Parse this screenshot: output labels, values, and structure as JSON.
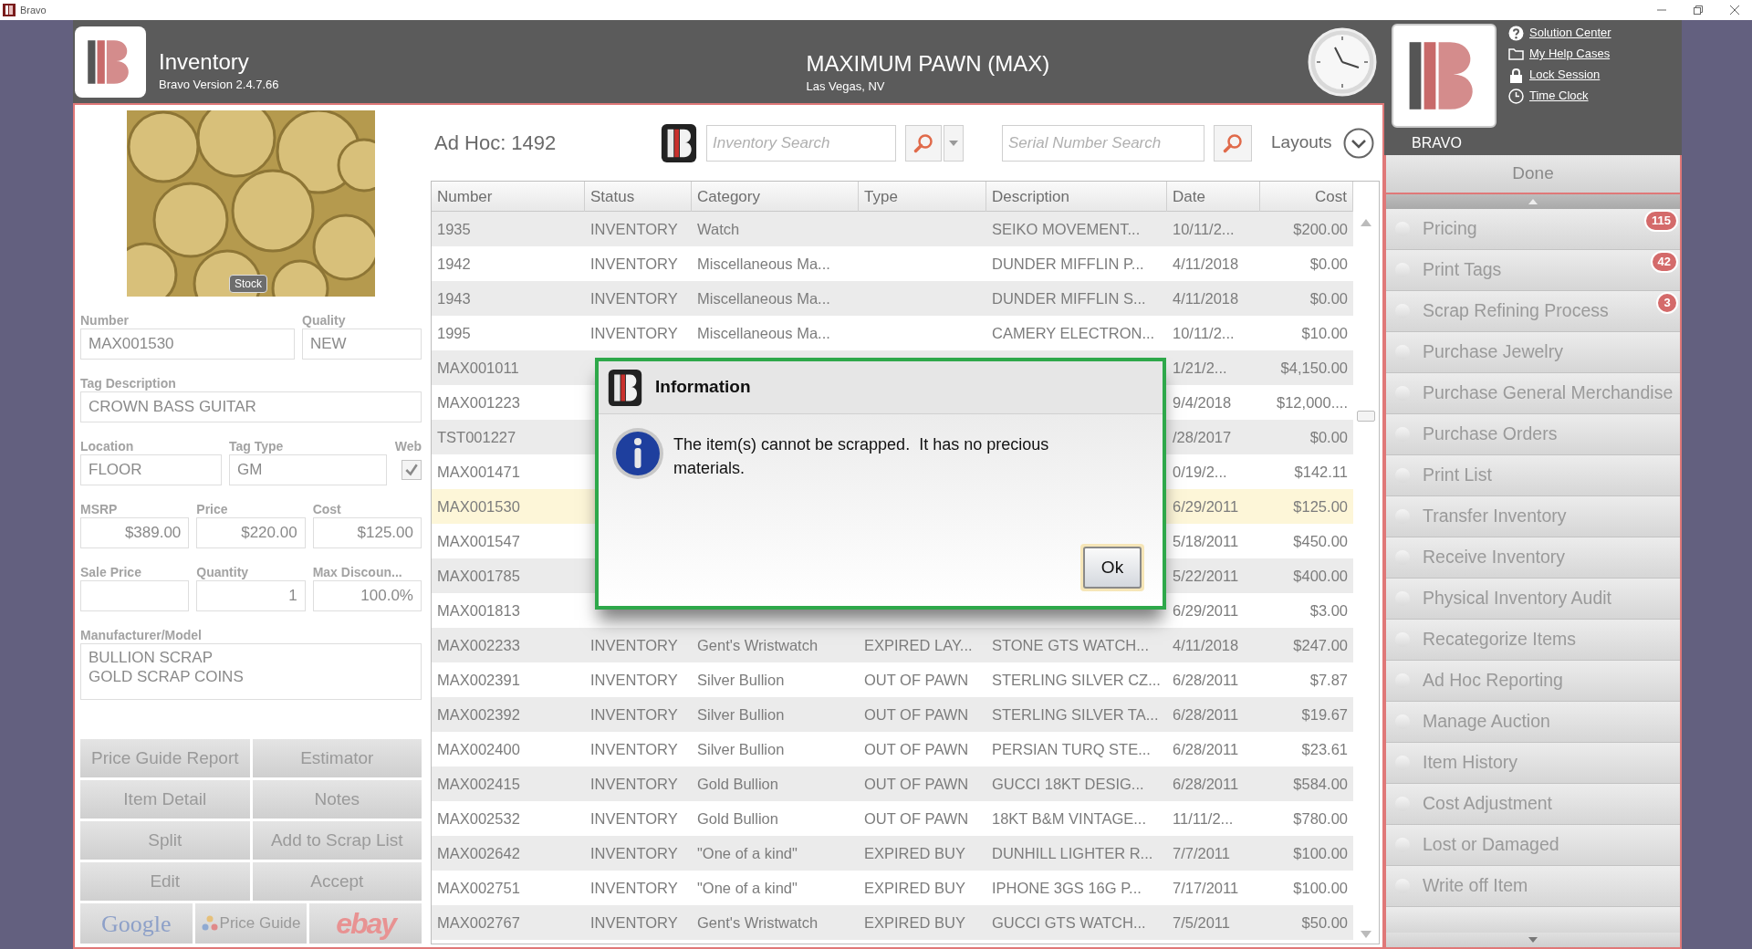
{
  "window": {
    "title": "Bravo"
  },
  "header": {
    "module": "Inventory",
    "version": "Bravo Version 2.4.7.66",
    "store": "MAXIMUM PAWN (MAX)",
    "location": "Las Vegas, NV",
    "brand_label": "BRAVO",
    "links": [
      {
        "kind": "help",
        "label": "Solution Center"
      },
      {
        "kind": "folder",
        "label": "My Help Cases"
      },
      {
        "kind": "lock",
        "label": "Lock Session"
      },
      {
        "kind": "clock",
        "label": "Time Clock"
      }
    ]
  },
  "item_form": {
    "image_badge": "Stock",
    "fields": [
      {
        "label": "Number",
        "value": "MAX001530",
        "kind": "text"
      },
      {
        "label": "Quality",
        "value": "NEW",
        "kind": "text"
      },
      {
        "label": "Tag Description",
        "value": "CROWN BASS GUITAR",
        "kind": "text"
      },
      {
        "label": "Location",
        "value": "FLOOR",
        "kind": "text"
      },
      {
        "label": "Tag Type",
        "value": "GM",
        "kind": "text"
      },
      {
        "label": "Web",
        "checked": true,
        "kind": "checkbox"
      },
      {
        "label": "MSRP",
        "value": "$389.00",
        "kind": "number"
      },
      {
        "label": "Price",
        "value": "$220.00",
        "kind": "number"
      },
      {
        "label": "Cost",
        "value": "$125.00",
        "kind": "number"
      },
      {
        "label": "Sale Price",
        "kind": "number"
      },
      {
        "label": "Quantity",
        "value": "1",
        "kind": "number"
      },
      {
        "label": "Max Discoun...",
        "value": "100.0%",
        "kind": "number"
      },
      {
        "label": "Manufacturer/Model",
        "lines": [
          "BULLION SCRAP",
          "GOLD SCRAP COINS"
        ],
        "kind": "multiline"
      }
    ],
    "buttons": [
      "Price Guide Report",
      "Estimator",
      "Item Detail",
      "Notes",
      "Split",
      "Add to Scrap List",
      "Edit",
      "Accept"
    ],
    "lookups": [
      {
        "kind": "google",
        "label": "Google"
      },
      {
        "kind": "price_guide",
        "label": "Price Guide"
      },
      {
        "kind": "ebay",
        "label": "ebay"
      }
    ]
  },
  "toolbar": {
    "title": "Ad Hoc: 1492",
    "inventory_search": {
      "placeholder": "Inventory Search"
    },
    "serial_search": {
      "placeholder": "Serial Number Search"
    },
    "layouts": "Layouts"
  },
  "table": {
    "columns": [
      "Number",
      "Status",
      "Category",
      "Type",
      "Description",
      "Date",
      "Cost"
    ],
    "rows": [
      {
        "number": "1935",
        "status": "INVENTORY",
        "category": "Watch",
        "description": "SEIKO MOVEMENT...",
        "date": "10/11/2...",
        "cost": "$200.00",
        "selected": false
      },
      {
        "number": "1942",
        "status": "INVENTORY",
        "category": "Miscellaneous Ma...",
        "description": "DUNDER MIFFLIN P...",
        "date": "4/11/2018",
        "cost": "$0.00",
        "selected": false
      },
      {
        "number": "1943",
        "status": "INVENTORY",
        "category": "Miscellaneous Ma...",
        "description": "DUNDER MIFFLIN S...",
        "date": "4/11/2018",
        "cost": "$0.00",
        "selected": false
      },
      {
        "number": "1995",
        "status": "INVENTORY",
        "category": "Miscellaneous Ma...",
        "description": "CAMERY ELECTRON...",
        "date": "10/11/2...",
        "cost": "$10.00",
        "selected": false
      },
      {
        "number": "MAX001011",
        "date": "1/21/2...",
        "cost": "$4,150.00",
        "selected": false
      },
      {
        "number": "MAX001223",
        "date": "9/4/2018",
        "cost": "$12,000....",
        "selected": false
      },
      {
        "number": "TST001227",
        "date": "/28/2017",
        "cost": "$0.00",
        "selected": false
      },
      {
        "number": "MAX001471",
        "date": "0/19/2...",
        "cost": "$142.11",
        "selected": false
      },
      {
        "number": "MAX001530",
        "date": "6/29/2011",
        "cost": "$125.00",
        "selected": true
      },
      {
        "number": "MAX001547",
        "date": "5/18/2011",
        "cost": "$450.00",
        "selected": false
      },
      {
        "number": "MAX001785",
        "date": "5/22/2011",
        "cost": "$400.00",
        "selected": false
      },
      {
        "number": "MAX001813",
        "date": "6/29/2011",
        "cost": "$3.00",
        "selected": false
      },
      {
        "number": "MAX002233",
        "status": "INVENTORY",
        "category": "Gent's Wristwatch",
        "type": "EXPIRED LAY...",
        "description": "STONE GTS WATCH...",
        "date": "4/11/2018",
        "cost": "$247.00",
        "selected": false
      },
      {
        "number": "MAX002391",
        "status": "INVENTORY",
        "category": "Silver Bullion",
        "type": "OUT OF PAWN",
        "description": "STERLING SILVER CZ...",
        "date": "6/28/2011",
        "cost": "$7.87",
        "selected": false
      },
      {
        "number": "MAX002392",
        "status": "INVENTORY",
        "category": "Silver Bullion",
        "type": "OUT OF PAWN",
        "description": "STERLING SILVER TA...",
        "date": "6/28/2011",
        "cost": "$19.67",
        "selected": false
      },
      {
        "number": "MAX002400",
        "status": "INVENTORY",
        "category": "Silver Bullion",
        "type": "OUT OF PAWN",
        "description": "PERSIAN TURQ STE...",
        "date": "6/28/2011",
        "cost": "$23.61",
        "selected": false
      },
      {
        "number": "MAX002415",
        "status": "INVENTORY",
        "category": "Gold Bullion",
        "type": "OUT OF PAWN",
        "description": "GUCCI 18KT DESIG...",
        "date": "6/28/2011",
        "cost": "$584.00",
        "selected": false
      },
      {
        "number": "MAX002532",
        "status": "INVENTORY",
        "category": "Gold Bullion",
        "type": "OUT OF PAWN",
        "description": "18KT B&M VINTAGE...",
        "date": "11/11/2...",
        "cost": "$780.00",
        "selected": false
      },
      {
        "number": "MAX002642",
        "status": "INVENTORY",
        "category": "\"One of a kind\"",
        "type": "EXPIRED BUY",
        "description": "DUNHILL LIGHTER R...",
        "date": "7/7/2011",
        "cost": "$100.00",
        "selected": false
      },
      {
        "number": "MAX002751",
        "status": "INVENTORY",
        "category": "\"One of a kind\"",
        "type": "EXPIRED BUY",
        "description": "IPHONE 3GS 16G P...",
        "date": "7/17/2011",
        "cost": "$100.00",
        "selected": false
      },
      {
        "number": "MAX002767",
        "status": "INVENTORY",
        "category": "Gent's Wristwatch",
        "type": "EXPIRED BUY",
        "description": "GUCCI GTS WATCH...",
        "date": "7/5/2011",
        "cost": "$50.00",
        "selected": false
      }
    ]
  },
  "sidebar": {
    "done": "Done",
    "items": [
      {
        "label": "Pricing",
        "badge": "115"
      },
      {
        "label": "Print Tags",
        "badge": "42"
      },
      {
        "label": "Scrap Refining Process",
        "badge": "3"
      },
      {
        "label": "Purchase Jewelry"
      },
      {
        "label": "Purchase General Merchandise"
      },
      {
        "label": "Purchase Orders"
      },
      {
        "label": "Print List"
      },
      {
        "label": "Transfer Inventory"
      },
      {
        "label": "Receive Inventory"
      },
      {
        "label": "Physical Inventory Audit"
      },
      {
        "label": "Recategorize Items"
      },
      {
        "label": "Ad Hoc Reporting"
      },
      {
        "label": "Manage Auction"
      },
      {
        "label": "Item History"
      },
      {
        "label": "Cost Adjustment"
      },
      {
        "label": "Lost or Damaged"
      },
      {
        "label": "Write off Item"
      }
    ]
  },
  "dialog": {
    "title": "Information",
    "message": "The item(s) cannot be scrapped.  It has no precious materials.",
    "button": "Ok"
  }
}
